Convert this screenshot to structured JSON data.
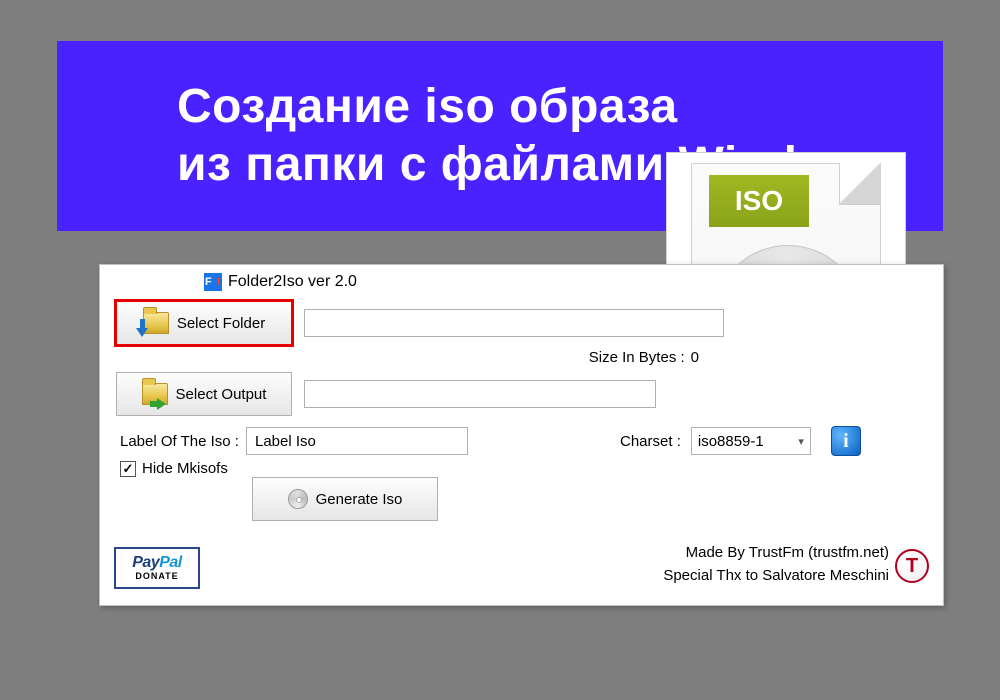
{
  "banner": {
    "line1": "Создание iso образа",
    "line2": "из папки с файлами Windows"
  },
  "iso_icon": {
    "tag": "ISO"
  },
  "app": {
    "title": "Folder2Iso ver 2.0",
    "select_folder_label": "Select Folder",
    "select_folder_value": "",
    "size_label": "Size In Bytes :",
    "size_value": "0",
    "select_output_label": "Select Output",
    "select_output_value": "",
    "label_of_iso_text": "Label Of The Iso :",
    "label_of_iso_value": "Label Iso",
    "charset_label": "Charset :",
    "charset_value": "iso8859-1",
    "hide_mkisofs_label": "Hide Mkisofs",
    "hide_mkisofs_checked": true,
    "generate_label": "Generate Iso",
    "credits_line1": "Made By TrustFm (trustfm.net)",
    "credits_line2": "Special Thx to Salvatore Meschini",
    "paypal_brand": "PayPal",
    "paypal_sub": "DONATE",
    "info_letter": "i",
    "t_logo": "T"
  }
}
